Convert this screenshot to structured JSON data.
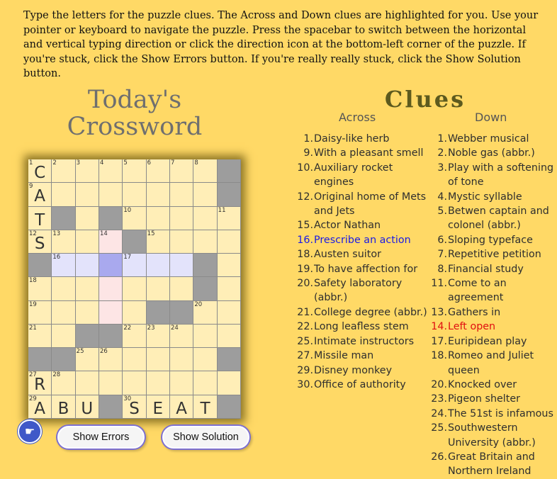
{
  "instructions": "Type the letters for the puzzle clues. The Across and Down clues are highlighted for you. Use your pointer or keyboard to navigate the puzzle. Press the spacebar to switch between the horizontal and vertical typing direction or click the direction icon at the bottom-left corner of the puzzle. If you're stuck, click the Show Errors button. If you're really really stuck, click the Show Solution button.",
  "title_line1": "Today's",
  "title_line2": "Crossword",
  "grid": {
    "rows": [
      [
        {
          "n": "1",
          "l": "C"
        },
        {
          "n": "2"
        },
        {
          "n": "3"
        },
        {
          "n": "4"
        },
        {
          "n": "5"
        },
        {
          "n": "6"
        },
        {
          "n": "7"
        },
        {
          "n": "8"
        },
        {
          "b": 1
        }
      ],
      [
        {
          "n": "9",
          "l": "A"
        },
        {},
        {},
        {},
        {},
        {},
        {},
        {},
        {
          "b": 1
        }
      ],
      [
        {
          "l": "T"
        },
        {
          "b": 1
        },
        {},
        {
          "b": 1
        },
        {
          "n": "10"
        },
        {},
        {},
        {},
        {
          "n": "11"
        }
      ],
      [
        {
          "n": "12",
          "l": "S"
        },
        {
          "n": "13"
        },
        {},
        {
          "n": "14",
          "s": "dl"
        },
        {
          "b": 1
        },
        {
          "n": "15"
        },
        {},
        {},
        {}
      ],
      [
        {
          "b": 1
        },
        {
          "n": "16",
          "s": "hl"
        },
        {
          "s": "hl"
        },
        {
          "s": "sel"
        },
        {
          "n": "17",
          "s": "hl"
        },
        {
          "s": "hl"
        },
        {
          "s": "hl"
        },
        {
          "b": 1
        },
        {}
      ],
      [
        {
          "n": "18"
        },
        {},
        {},
        {
          "s": "dl"
        },
        {},
        {},
        {},
        {
          "b": 1
        },
        {}
      ],
      [
        {
          "n": "19"
        },
        {},
        {},
        {
          "s": "dl"
        },
        {},
        {
          "b": 1
        },
        {
          "b": 1
        },
        {
          "n": "20"
        },
        {}
      ],
      [
        {
          "n": "21"
        },
        {},
        {
          "b": 1
        },
        {
          "b": 1
        },
        {
          "n": "22"
        },
        {
          "n": "23"
        },
        {
          "n": "24"
        },
        {},
        {}
      ],
      [
        {
          "b": 1
        },
        {
          "b": 1
        },
        {
          "n": "25"
        },
        {
          "n": "26"
        },
        {},
        {},
        {},
        {},
        {
          "b": 1
        }
      ],
      [
        {
          "n": "27",
          "l": "R"
        },
        {
          "n": "28"
        },
        {},
        {},
        {},
        {},
        {},
        {},
        {}
      ],
      [
        {
          "n": "29",
          "l": "A"
        },
        {
          "l": "B"
        },
        {
          "l": "U"
        },
        {
          "b": 1
        },
        {
          "n": "30",
          "l": "S"
        },
        {
          "l": "E"
        },
        {
          "l": "A"
        },
        {
          "l": "T"
        },
        {
          "b": 1
        }
      ]
    ]
  },
  "buttons": {
    "direction_icon": "☛",
    "show_errors": "Show Errors",
    "show_solution": "Show Solution"
  },
  "clues": {
    "title": "Clues",
    "across_heading": "Across",
    "down_heading": "Down",
    "across": [
      {
        "num": "1.",
        "text": "Daisy-like herb"
      },
      {
        "num": "9.",
        "text": "With a pleasant smell"
      },
      {
        "num": "10.",
        "text": "Auxiliary rocket engines"
      },
      {
        "num": "12.",
        "text": "Original home of Mets and Jets"
      },
      {
        "num": "15.",
        "text": "Actor Nathan"
      },
      {
        "num": "16.",
        "text": "Prescribe an action",
        "active": true
      },
      {
        "num": "18.",
        "text": "Austen suitor"
      },
      {
        "num": "19.",
        "text": "To have affection for"
      },
      {
        "num": "20.",
        "text": "Safety laboratory (abbr.)"
      },
      {
        "num": "21.",
        "text": "College degree (abbr.)"
      },
      {
        "num": "22.",
        "text": "Long leafless stem"
      },
      {
        "num": "25.",
        "text": "Intimate instructors"
      },
      {
        "num": "27.",
        "text": "Missile man"
      },
      {
        "num": "29.",
        "text": "Disney monkey"
      },
      {
        "num": "30.",
        "text": "Office of authority"
      }
    ],
    "down": [
      {
        "num": "1.",
        "text": "Webber musical"
      },
      {
        "num": "2.",
        "text": "Noble gas (abbr.)"
      },
      {
        "num": "3.",
        "text": "Play with a softening of tone"
      },
      {
        "num": "4.",
        "text": "Mystic syllable"
      },
      {
        "num": "5.",
        "text": "Betwen captain and colonel (abbr.)"
      },
      {
        "num": "6.",
        "text": "Sloping typeface"
      },
      {
        "num": "7.",
        "text": "Repetitive petition"
      },
      {
        "num": "8.",
        "text": "Financial study"
      },
      {
        "num": "11.",
        "text": "Come to an agreement"
      },
      {
        "num": "13.",
        "text": "Gathers in"
      },
      {
        "num": "14.",
        "text": "Left open",
        "active": true
      },
      {
        "num": "17.",
        "text": "Euripidean play"
      },
      {
        "num": "18.",
        "text": "Romeo and Juliet queen"
      },
      {
        "num": "20.",
        "text": "Knocked over"
      },
      {
        "num": "23.",
        "text": "Pigeon shelter"
      },
      {
        "num": "24.",
        "text": "The 51st is infamous"
      },
      {
        "num": "25.",
        "text": "Southwestern University (abbr.)"
      },
      {
        "num": "26.",
        "text": "Great Britain and Northern Ireland"
      }
    ]
  },
  "colors": {
    "background": "#ffd966",
    "cell": "#ffeeb7",
    "block": "#9d9d9d",
    "across_highlight": "#e3e3fb",
    "selected": "#a9a9ee",
    "down_highlight": "#fde5e5",
    "active_across_clue": "#1a1ae6",
    "active_down_clue": "#e01010"
  }
}
